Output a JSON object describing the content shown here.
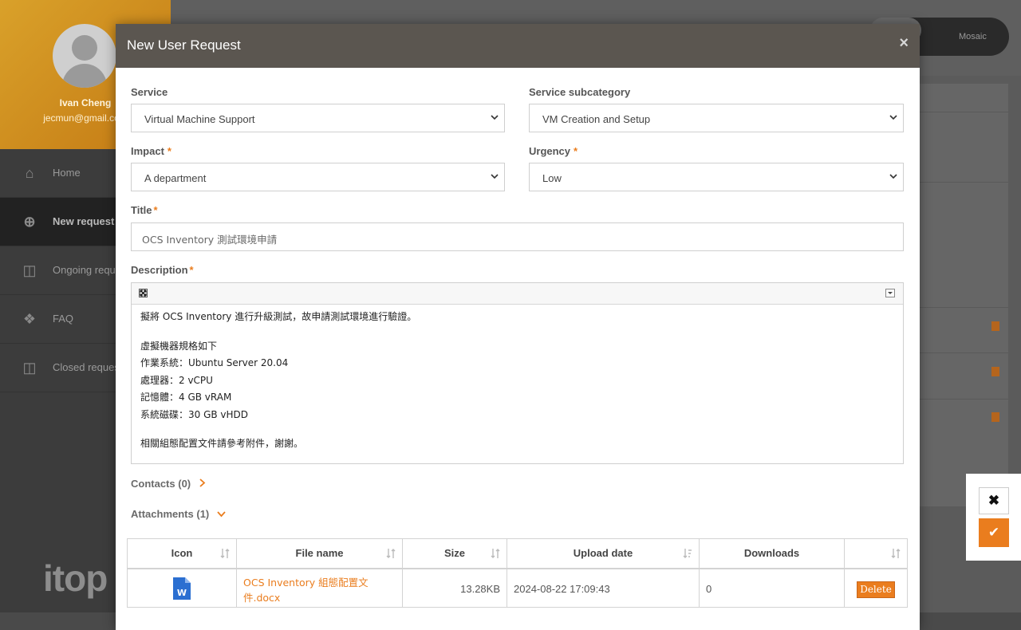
{
  "background": {
    "user_name": "Ivan Cheng",
    "user_email": "jecmun@gmail.com",
    "menu": [
      {
        "label": "Home",
        "icon": "home-icon"
      },
      {
        "label": "New request",
        "icon": "plus-circle-icon"
      },
      {
        "label": "Ongoing requests",
        "icon": "ticket-icon"
      },
      {
        "label": "FAQ",
        "icon": "help-icon"
      },
      {
        "label": "Closed requests",
        "icon": "ticket-closed-icon"
      }
    ],
    "logo": "itop",
    "toggle_label": "Mosaic",
    "toggle_active": "List"
  },
  "modal": {
    "title": "New User Request",
    "close_glyph": "×",
    "service": {
      "label": "Service",
      "value": "Virtual Machine Support"
    },
    "subcategory": {
      "label": "Service subcategory",
      "value": "VM Creation and Setup"
    },
    "impact": {
      "label": "Impact",
      "required": "*",
      "value": "A department"
    },
    "urgency": {
      "label": "Urgency",
      "required": "*",
      "value": "Low"
    },
    "title_field": {
      "label": "Title",
      "required": "*",
      "value": "OCS Inventory 測試環境申請"
    },
    "description": {
      "label": "Description",
      "required": "*",
      "lines": [
        "擬將 OCS Inventory 進行升級測試，故申請測試環境進行驗證。",
        "",
        "虛擬機器規格如下",
        "作業系統：Ubuntu Server 20.04",
        "處理器：2 vCPU",
        "記憶體：4 GB vRAM",
        "系統磁碟：30 GB vHDD",
        "",
        "相關組態配置文件請參考附件，謝謝。"
      ]
    },
    "contacts": {
      "label": "Contacts",
      "count": "(0)"
    },
    "attachments": {
      "label": "Attachments",
      "count": "(1)",
      "columns": [
        "Icon",
        "File name",
        "Size",
        "Upload date",
        "Downloads",
        ""
      ],
      "rows": [
        {
          "icon": "word-doc-icon",
          "file_name": "OCS Inventory 組態配置文件.docx",
          "size": "13.28KB",
          "upload_date": "2024-08-22 17:09:43",
          "downloads": "0",
          "action": "Delete"
        }
      ]
    }
  },
  "actions": {
    "cancel_glyph": "✖",
    "confirm_glyph": "✔"
  },
  "colors": {
    "accent": "#ea7d1e",
    "header": "#5b5650"
  }
}
